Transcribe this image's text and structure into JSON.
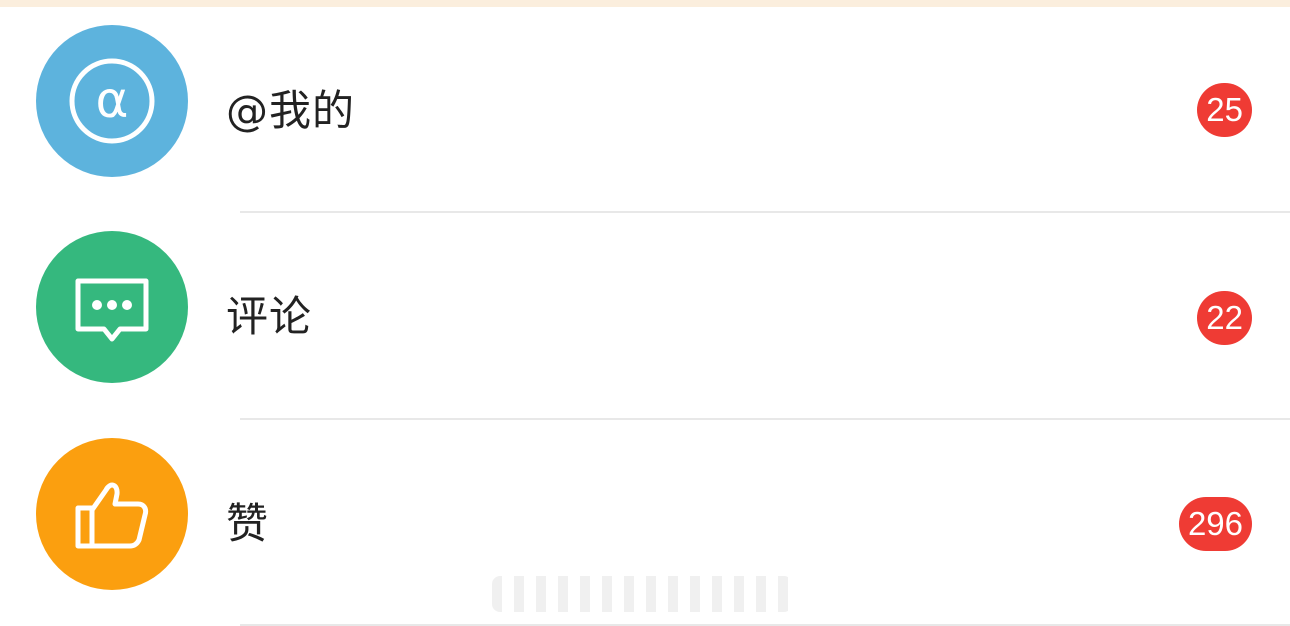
{
  "colors": {
    "top_band": "#fbeedd",
    "at_me_icon_bg": "#5db3dd",
    "comments_icon_bg": "#35b87e",
    "likes_icon_bg": "#fb9f0f",
    "badge_bg": "#ef3b34",
    "label_text": "#222222",
    "divider": "#e8e8e8"
  },
  "items": [
    {
      "icon": "at-sign-icon",
      "label": "@我的",
      "count": "25"
    },
    {
      "icon": "comment-bubble-icon",
      "label": "评论",
      "count": "22"
    },
    {
      "icon": "thumbs-up-icon",
      "label": "赞",
      "count": "296"
    }
  ]
}
